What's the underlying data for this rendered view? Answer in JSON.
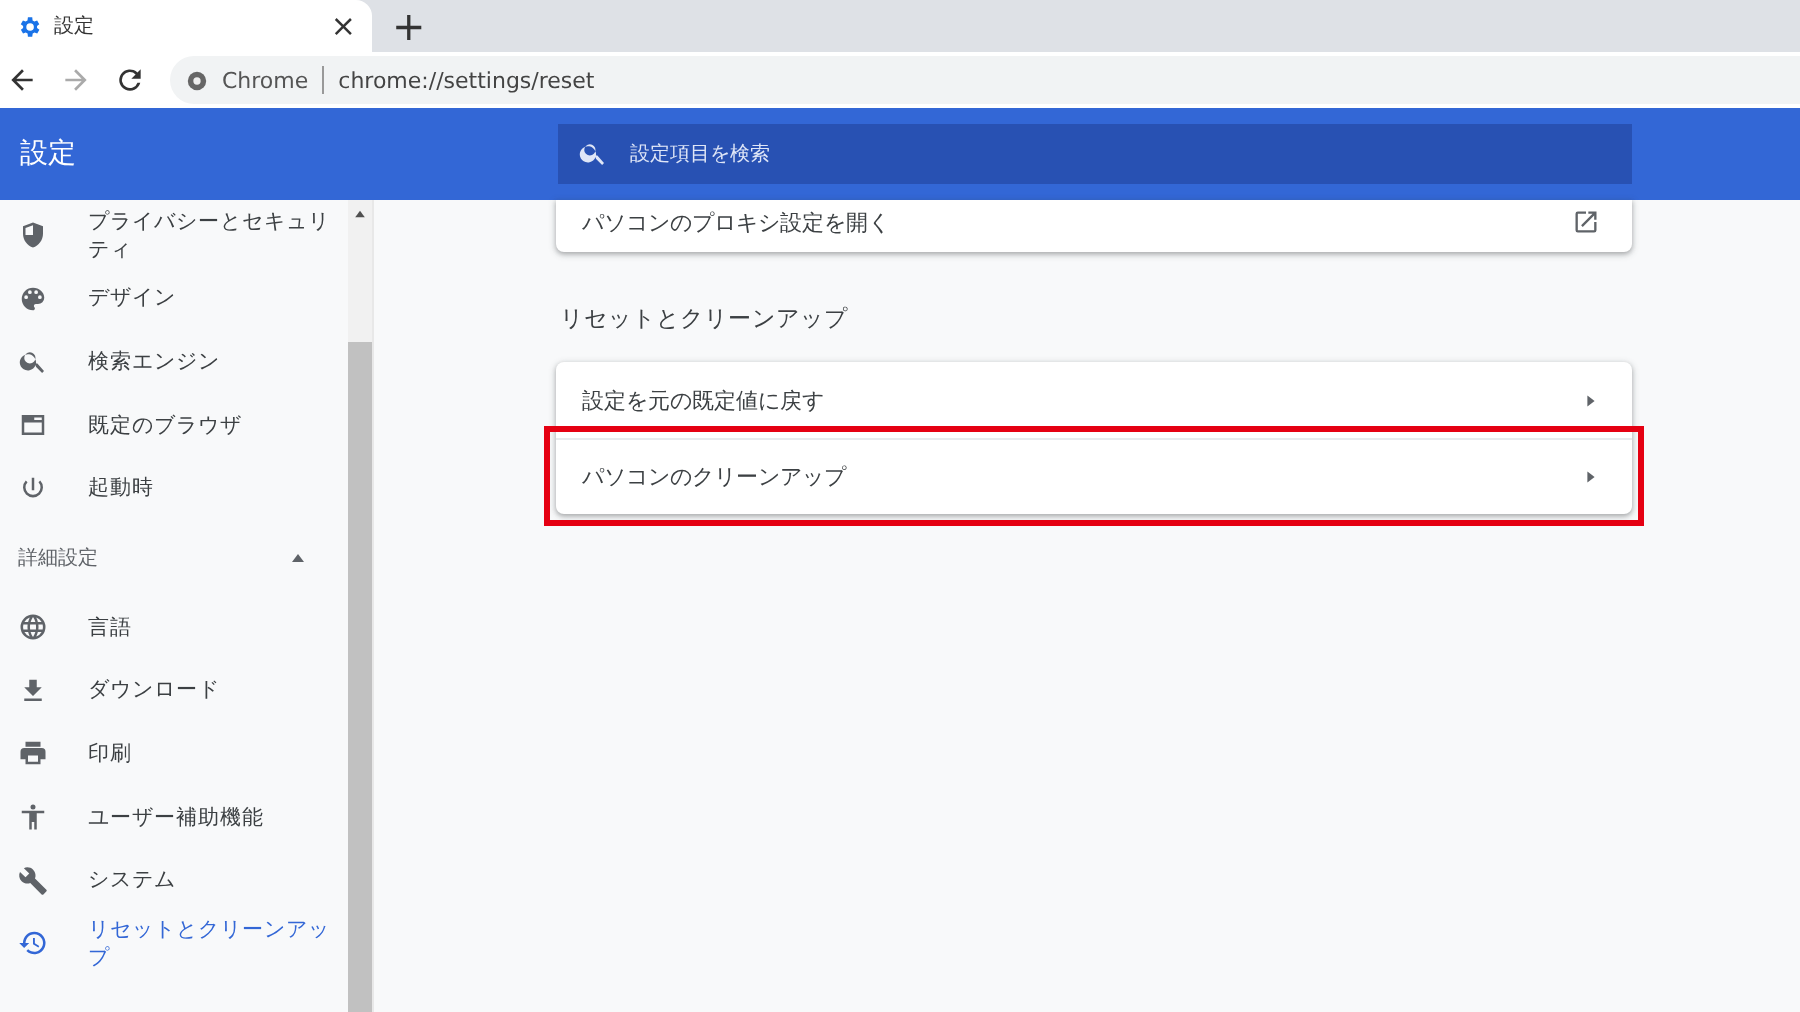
{
  "browser": {
    "tab": {
      "title": "設定",
      "close": "×"
    },
    "new_tab": "+",
    "address": {
      "site": "Chrome",
      "url": "chrome://settings/reset"
    }
  },
  "header": {
    "title": "設定",
    "search": {
      "placeholder": "設定項目を検索"
    }
  },
  "sidebar": {
    "items": [
      {
        "kind": "shield",
        "label": "プライバシーとセキュリティ",
        "selected": false
      },
      {
        "kind": "palette",
        "label": "デザイン",
        "selected": false
      },
      {
        "kind": "search",
        "label": "検索エンジン",
        "selected": false
      },
      {
        "kind": "browser",
        "label": "既定のブラウザ",
        "selected": false
      },
      {
        "kind": "power",
        "label": "起動時",
        "selected": false
      }
    ],
    "advanced": {
      "label": "詳細設定",
      "expanded": true,
      "items": [
        {
          "kind": "globe",
          "label": "言語",
          "selected": false
        },
        {
          "kind": "download",
          "label": "ダウンロード",
          "selected": false
        },
        {
          "kind": "print",
          "label": "印刷",
          "selected": false
        },
        {
          "kind": "person",
          "label": "ユーザー補助機能",
          "selected": false
        },
        {
          "kind": "wrench",
          "label": "システム",
          "selected": false
        },
        {
          "kind": "history",
          "label": "リセットとクリーンアップ",
          "selected": true
        }
      ]
    }
  },
  "content": {
    "top_card": {
      "rows": [
        {
          "label": "パソコンのプロキシ設定を開く",
          "kind": "external"
        }
      ]
    },
    "section": {
      "title": "リセットとクリーンアップ",
      "rows": [
        {
          "label": "設定を元の既定値に戻す",
          "kind": "arrow",
          "highlighted": false
        },
        {
          "label": "パソコンのクリーンアップ",
          "kind": "arrow",
          "highlighted": true
        }
      ]
    }
  }
}
